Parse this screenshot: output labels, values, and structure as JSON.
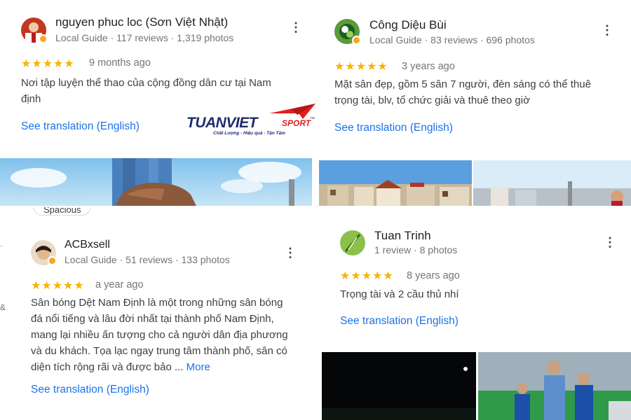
{
  "reviews": [
    {
      "name": "nguyen phuc loc (Sơn Việt Nhật)",
      "meta": "Local Guide · 117 reviews · 1,319 photos",
      "stars": "★★★★★",
      "time": "9 months ago",
      "lines": [
        "Nơi tập luyện thể thao của cộng đồng dân cư tại Nam",
        "định"
      ],
      "translate": "See translation (English)"
    },
    {
      "name": "Công Diệu Bùi",
      "meta": "Local Guide · 83 reviews · 696 photos",
      "stars": "★★★★★",
      "time": "3 years ago",
      "lines": [
        "Mặt sân đẹp, gồm 5 sân 7 người, đèn sáng có thể thuê",
        "trọng tài, blv, tổ chức giải và thuê theo giờ"
      ],
      "translate": "See translation (English)"
    },
    {
      "name": "ACBxsell",
      "meta": "Local Guide · 51 reviews · 133 photos",
      "stars": "★★★★★",
      "time": "a year ago",
      "lines": [
        "Sân bóng Dệt Nam Định là một trong những sân bóng",
        "đá nổi tiếng và lâu đời nhất tại thành phố Nam Định,",
        "mang lại nhiều ấn tượng cho cả người dân địa phương",
        "và du khách. Tọa lạc ngay trung tâm thành phố, sân có"
      ],
      "last_line": "diện tích rộng rãi và được bảo ...",
      "more": "More",
      "translate": "See translation (English)"
    },
    {
      "name": "Tuan Trinh",
      "meta": "1 review · 8 photos",
      "stars": "★★★★★",
      "time": "8 years ago",
      "lines": [
        "Trọng tài và 2 cầu thủ nhí"
      ],
      "translate": "See translation (English)"
    }
  ],
  "watermark": {
    "brand": "TUANVIET",
    "sport": "SPORT",
    "tm": "™",
    "tagline": "Chất Lượng - Hiệu quả - Tận Tâm"
  },
  "partial_chip": "Spacious",
  "colors": {
    "link": "#1a73e8",
    "star": "#f6b400",
    "brand": "#1d2d6b",
    "brand_red": "#e02020"
  }
}
